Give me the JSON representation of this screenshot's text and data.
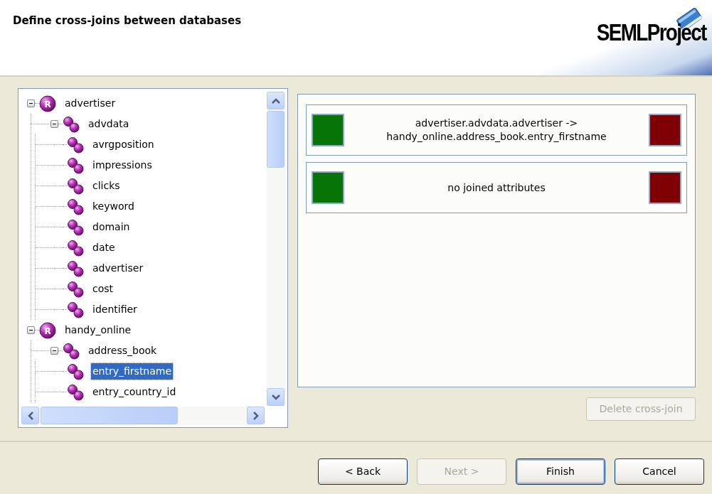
{
  "header": {
    "title": "Define cross-joins between databases",
    "logo": "SEMLProject"
  },
  "tree": [
    {
      "label": "advertiser",
      "kind": "database",
      "icon_label": "R",
      "expanded": true,
      "selected": false,
      "children": [
        {
          "label": "advdata",
          "kind": "table",
          "expanded": true,
          "selected": false,
          "children": [
            {
              "label": "avrgposition",
              "kind": "column",
              "selected": false
            },
            {
              "label": "impressions",
              "kind": "column",
              "selected": false
            },
            {
              "label": "clicks",
              "kind": "column",
              "selected": false
            },
            {
              "label": "keyword",
              "kind": "column",
              "selected": false
            },
            {
              "label": "domain",
              "kind": "column",
              "selected": false
            },
            {
              "label": "date",
              "kind": "column",
              "selected": false
            },
            {
              "label": "advertiser",
              "kind": "column",
              "selected": false
            },
            {
              "label": "cost",
              "kind": "column",
              "selected": false
            },
            {
              "label": "identifier",
              "kind": "column",
              "selected": false
            }
          ]
        }
      ]
    },
    {
      "label": "handy_online",
      "kind": "database",
      "icon_label": "R",
      "expanded": true,
      "selected": false,
      "children": [
        {
          "label": "address_book",
          "kind": "table",
          "expanded": true,
          "selected": false,
          "children": [
            {
              "label": "entry_firstname",
              "kind": "column",
              "selected": true
            },
            {
              "label": "entry_country_id",
              "kind": "column",
              "selected": false
            }
          ]
        }
      ]
    }
  ],
  "cross_joins": [
    {
      "text": "advertiser.advdata.advertiser ->\nhandy_online.address_book.entry_firstname"
    },
    {
      "text": "no joined attributes"
    }
  ],
  "delete_button": {
    "label": "Delete cross-join",
    "disabled": true
  },
  "buttons": [
    {
      "label": "< Back",
      "disabled": false,
      "default": false
    },
    {
      "label": "Next >",
      "disabled": true,
      "default": false
    },
    {
      "label": "Finish",
      "disabled": false,
      "default": true
    },
    {
      "label": "Cancel",
      "disabled": false,
      "default": false
    }
  ]
}
